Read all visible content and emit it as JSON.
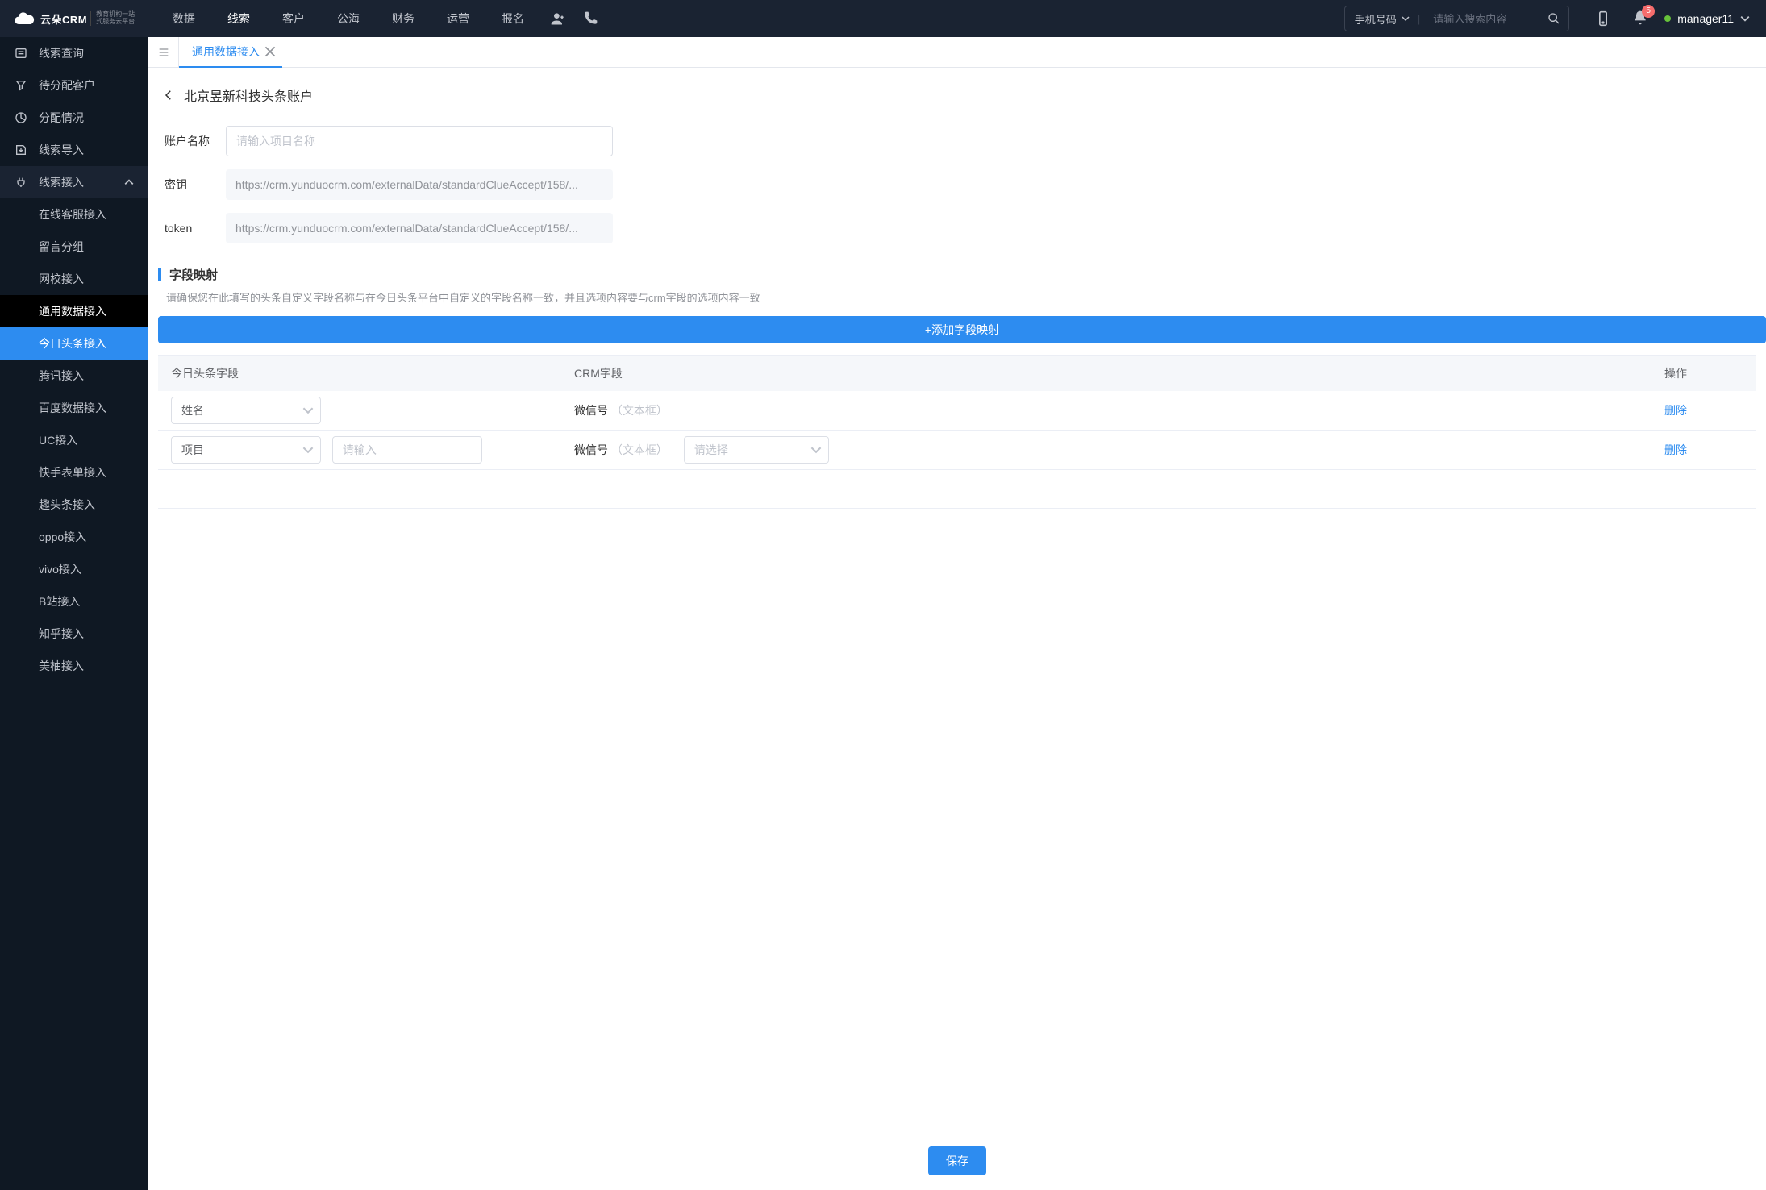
{
  "brand": {
    "name": "云朵CRM",
    "sub1": "教育机构一站",
    "sub2": "式服务云平台"
  },
  "topnav": [
    "数据",
    "线索",
    "客户",
    "公海",
    "财务",
    "运营",
    "报名"
  ],
  "topnav_active_index": 1,
  "search": {
    "type_label": "手机号码",
    "placeholder": "请输入搜索内容"
  },
  "notif_count": "5",
  "user": {
    "name": "manager11"
  },
  "sidebar": {
    "items": [
      {
        "label": "线索查询"
      },
      {
        "label": "待分配客户"
      },
      {
        "label": "分配情况"
      },
      {
        "label": "线索导入"
      },
      {
        "label": "线索接入",
        "expanded": true
      }
    ],
    "sub": [
      "在线客服接入",
      "留言分组",
      "网校接入",
      "通用数据接入",
      "今日头条接入",
      "腾讯接入",
      "百度数据接入",
      "UC接入",
      "快手表单接入",
      "趣头条接入",
      "oppo接入",
      "vivo接入",
      "B站接入",
      "知乎接入",
      "美柚接入"
    ],
    "sub_dark_index": 3,
    "sub_blue_index": 4
  },
  "tabs": {
    "active": "通用数据接入"
  },
  "page": {
    "breadcrumb": "北京昱新科技头条账户",
    "form": {
      "account_label": "账户名称",
      "account_placeholder": "请输入项目名称",
      "secret_label": "密钥",
      "secret_value": "https://crm.yunduocrm.com/externalData/standardClueAccept/158/...",
      "token_label": "token",
      "token_value": "https://crm.yunduocrm.com/externalData/standardClueAccept/158/..."
    },
    "mapping": {
      "title": "字段映射",
      "hint": "请确保您在此填写的头条自定义字段名称与在今日头条平台中自定义的字段名称一致，并且选项内容要与crm字段的选项内容一致",
      "add_btn": "+添加字段映射",
      "cols": {
        "tt": "今日头条字段",
        "crm": "CRM字段",
        "op": "操作"
      },
      "rows": [
        {
          "tt_sel": "姓名",
          "tt_input": null,
          "crm_name": "微信号",
          "crm_type": "（文本框）",
          "crm_sel": null,
          "del": "删除"
        },
        {
          "tt_sel": "项目",
          "tt_input_placeholder": "请输入",
          "crm_name": "微信号",
          "crm_type": "（文本框）",
          "crm_sel_placeholder": "请选择",
          "del": "删除"
        }
      ]
    },
    "save": "保存"
  }
}
